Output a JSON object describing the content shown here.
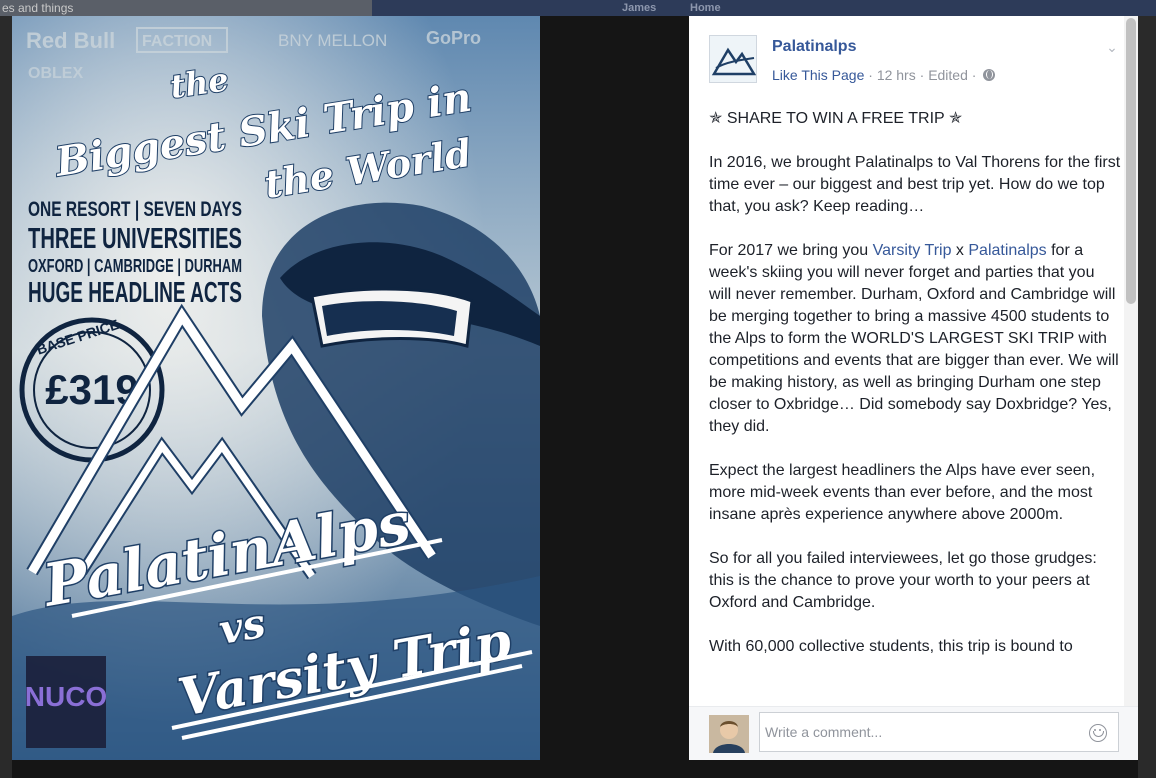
{
  "background": {
    "search_text": "es and things",
    "nav_items": [
      "James",
      "Home"
    ]
  },
  "photo": {
    "sponsors": [
      "Red Bull",
      "FACTION",
      "BNY MELLON",
      "GoPro",
      "OBLEX"
    ],
    "title_line1": "the",
    "title_line2": "Biggest Ski Trip in",
    "title_line3": "the World",
    "tagline1": "ONE RESORT | SEVEN DAYS",
    "tagline2": "THREE UNIVERSITIES",
    "tagline3": "OXFORD | CAMBRIDGE | DURHAM",
    "tagline4": "HUGE HEADLINE ACTS",
    "price_label": "BASE PRICE",
    "price": "£319",
    "brand1": "PalatinAlps",
    "versus": "vs",
    "brand2": "Varsity Trip",
    "logo_text": "NUCO",
    "colors": {
      "sky": "#9fb6c6",
      "deep": "#1f3f66",
      "white": "#ffffff"
    }
  },
  "post": {
    "page_name": "Palatinalps",
    "like_link": "Like This Page",
    "time": "12 hrs",
    "edited": "Edited",
    "separator": "·",
    "paragraphs": {
      "p1": "✯ SHARE TO WIN A FREE TRIP ✯",
      "p2": "In 2016, we brought Palatinalps to Val Thorens for the first time ever – our biggest and best trip yet. How do we top that, you ask? Keep reading…",
      "p3_before": "For 2017 we bring you ",
      "p3_link1": "Varsity Trip",
      "p3_mid": " x ",
      "p3_link2": "Palatinalps",
      "p3_after": " for a week's skiing you will never forget and parties that you will never remember. Durham, Oxford and Cambridge will be merging together to bring a massive 4500 students to the Alps to form the WORLD'S LARGEST SKI TRIP with competitions and events that are bigger than ever. We will be making history, as well as bringing Durham one step closer to Oxbridge… Did somebody say Doxbridge? Yes, they did.",
      "p4": "Expect the largest headliners the Alps have ever seen, more mid-week events than ever before, and the most insane après experience anywhere above 2000m.",
      "p5": "So for all you failed interviewees, let go those grudges: this is the chance to prove your worth to your peers at Oxford and Cambridge.",
      "p6": "With 60,000 collective students, this trip is bound to"
    },
    "link_color": "#365899"
  },
  "comment": {
    "placeholder": "Write a comment..."
  }
}
